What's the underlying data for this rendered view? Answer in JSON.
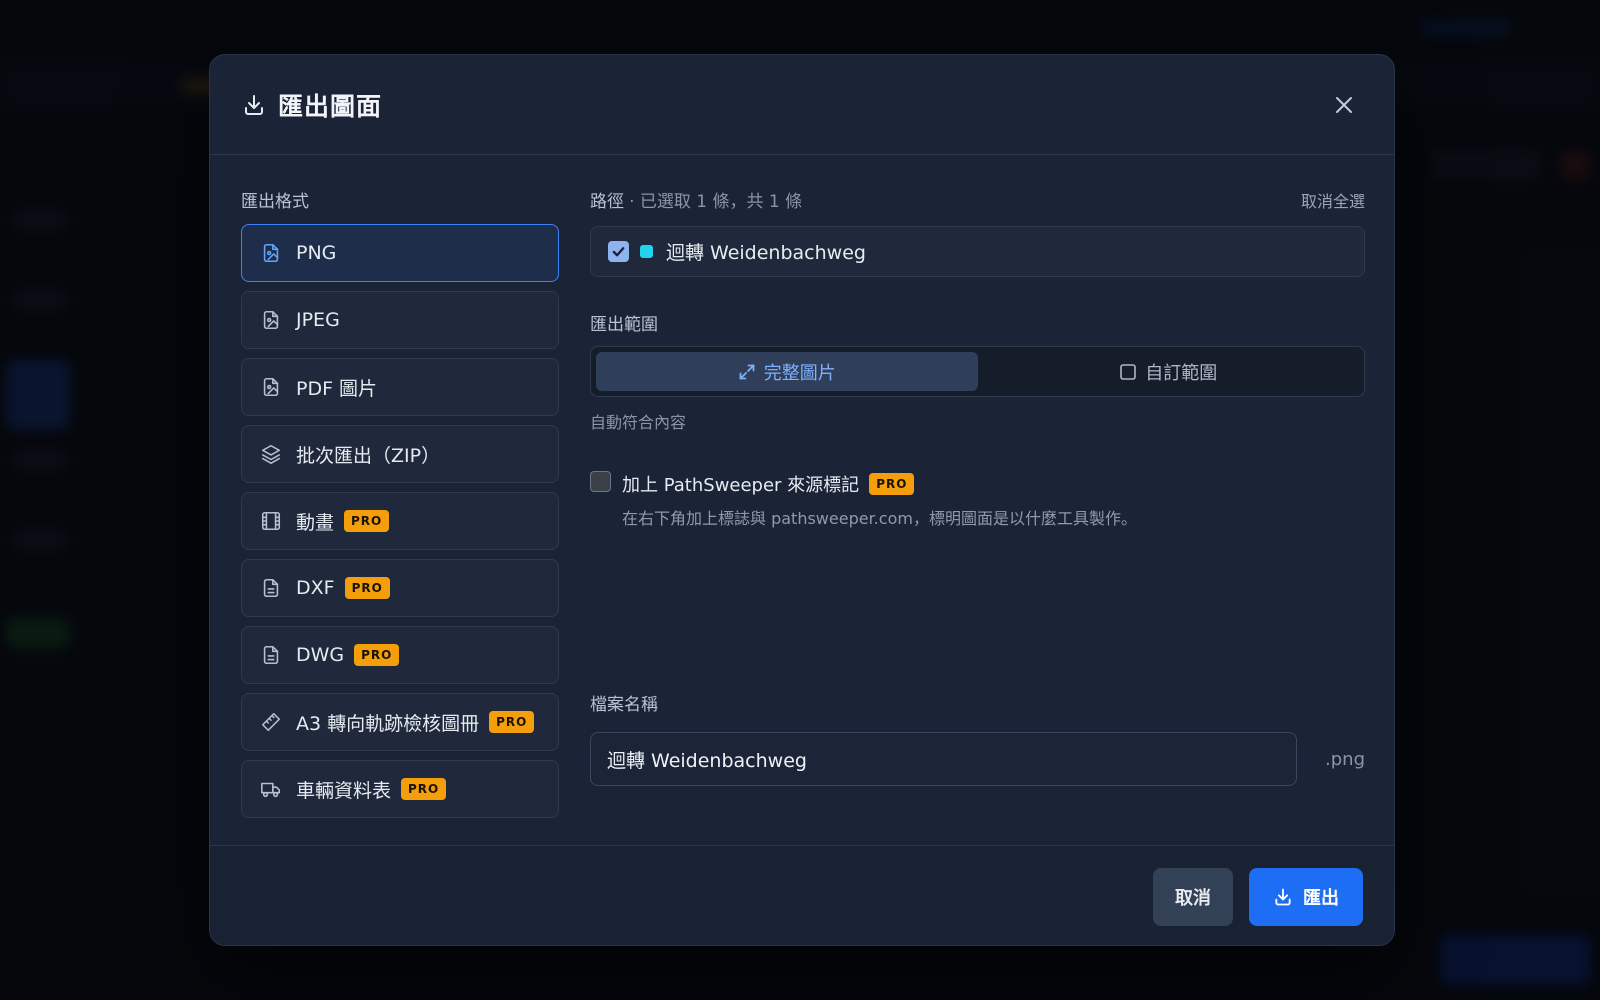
{
  "dialog": {
    "title": "匯出圖面",
    "title_icon": "download-icon",
    "close_icon": "close-icon"
  },
  "formats": {
    "label": "匯出格式",
    "items": [
      {
        "label": "PNG",
        "icon": "image-file-icon",
        "selected": true,
        "pro": false
      },
      {
        "label": "JPEG",
        "icon": "image-file-icon",
        "selected": false,
        "pro": false
      },
      {
        "label": "PDF 圖片",
        "icon": "image-file-icon",
        "selected": false,
        "pro": false
      },
      {
        "label": "批次匯出（ZIP）",
        "icon": "layers-icon",
        "selected": false,
        "pro": false
      },
      {
        "label": "動畫",
        "icon": "film-icon",
        "selected": false,
        "pro": true
      },
      {
        "label": "DXF",
        "icon": "document-icon",
        "selected": false,
        "pro": true
      },
      {
        "label": "DWG",
        "icon": "document-icon",
        "selected": false,
        "pro": true
      },
      {
        "label": "A3 轉向軌跡檢核圖冊",
        "icon": "ruler-icon",
        "selected": false,
        "pro": true
      },
      {
        "label": "車輛資料表",
        "icon": "truck-icon",
        "selected": false,
        "pro": true
      }
    ],
    "pro_badge": "PRO"
  },
  "paths": {
    "label": "路徑",
    "summary": "· 已選取 1 條，共 1 條",
    "deselect_all": "取消全選",
    "items": [
      {
        "name": "迴轉 Weidenbachweg",
        "checked": true,
        "color": "#22d3ee"
      }
    ]
  },
  "range": {
    "label": "匯出範圍",
    "options": [
      {
        "label": "完整圖片",
        "icon": "expand-icon",
        "active": true
      },
      {
        "label": "自訂範圍",
        "icon": "square-icon",
        "active": false
      }
    ],
    "hint": "自動符合內容"
  },
  "watermark": {
    "label": "加上 PathSweeper 來源標記",
    "badge": "PRO",
    "description": "在右下角加上標誌與 pathsweeper.com，標明圖面是以什麼工具製作。",
    "checked": false
  },
  "filename": {
    "label": "檔案名稱",
    "value": "迴轉 Weidenbachweg",
    "extension": ".png"
  },
  "footer": {
    "cancel_label": "取消",
    "export_label": "匯出"
  },
  "colors": {
    "accent": "#1d6ef5",
    "pro": "#f59e0b",
    "path_color": "#22d3ee"
  }
}
